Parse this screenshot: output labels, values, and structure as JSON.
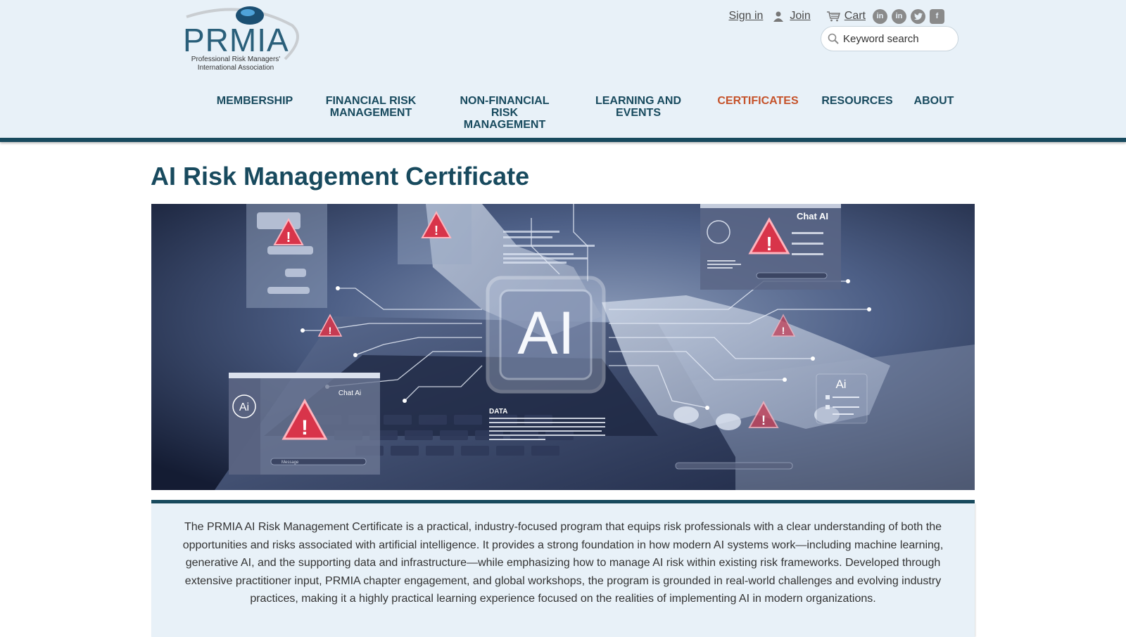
{
  "brand": {
    "logo_text": "PRMIA",
    "logo_sub_line1": "Professional Risk Managers'",
    "logo_sub_line2": "International Association"
  },
  "topbar": {
    "sign_in": "Sign in",
    "join": "Join",
    "cart": "Cart",
    "social_icons": [
      "linkedin-icon",
      "linkedin-icon",
      "twitter-icon",
      "facebook-icon"
    ]
  },
  "search": {
    "placeholder": "Keyword search"
  },
  "nav": {
    "items": [
      {
        "label": "MEMBERSHIP"
      },
      {
        "label": "FINANCIAL RISK MANAGEMENT"
      },
      {
        "label": "NON-FINANCIAL RISK MANAGEMENT"
      },
      {
        "label": "LEARNING AND EVENTS"
      },
      {
        "label": "CERTIFICATES",
        "active": true
      },
      {
        "label": "RESOURCES"
      },
      {
        "label": "ABOUT"
      }
    ],
    "active_color": "#c5522a",
    "color": "#184a5e"
  },
  "page": {
    "title": "AI Risk Management Certificate",
    "description": "The PRMIA AI Risk Management Certificate is a practical, industry-focused program that equips risk professionals with a clear understanding of both the opportunities and risks associated with artificial intelligence. It provides a strong foundation in how modern AI systems work—including machine learning, generative AI, and the supporting data and infrastructure—while emphasizing how to manage AI risk within existing risk frameworks. Developed through extensive practitioner input, PRMIA chapter engagement, and global workshops, the program is grounded in real-world challenges and evolving industry practices, making it a highly practical learning experience focused on the realities of implementing AI in modern organizations."
  },
  "hero": {
    "center_label": "AI",
    "panel_top_right_title": "Chat AI",
    "panel_bottom_left_title": "Chat Ai",
    "panel_bottom_left_badge": "Ai",
    "panel_right_badge": "Ai",
    "data_label": "DATA",
    "message_placeholder": "Message"
  },
  "colors": {
    "primary": "#184a5e",
    "accent": "#c5522a",
    "header_bg": "#e8f1f8"
  }
}
